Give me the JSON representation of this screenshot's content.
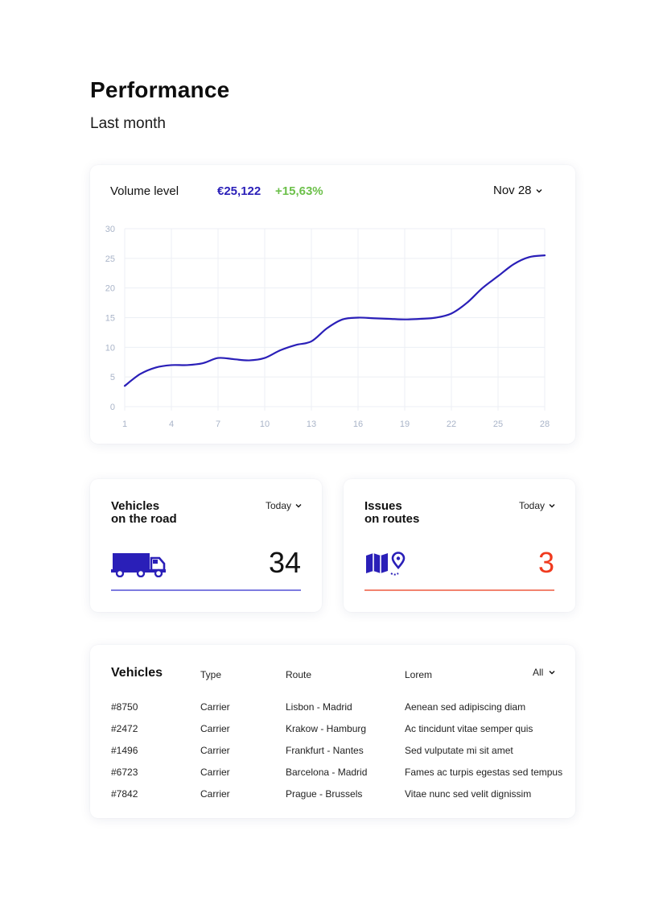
{
  "page": {
    "title": "Performance",
    "subtitle": "Last month"
  },
  "volume": {
    "label": "Volume level",
    "value": "€25,122",
    "change": "+15,63%",
    "date": "Nov 28",
    "line_color": "#2a1fb8",
    "value_color": "#2a1fb8",
    "change_color": "#6cc04a"
  },
  "chart_data": {
    "type": "line",
    "x": [
      1,
      2,
      3,
      4,
      5,
      6,
      7,
      8,
      9,
      10,
      11,
      12,
      13,
      14,
      15,
      16,
      17,
      18,
      19,
      20,
      21,
      22,
      23,
      24,
      25,
      26,
      27,
      28
    ],
    "series": [
      {
        "values": [
          3.5,
          5.5,
          6.6,
          7.0,
          7.0,
          7.3,
          8.2,
          8.0,
          7.8,
          8.2,
          9.5,
          10.4,
          11.0,
          13.2,
          14.7,
          15.0,
          14.9,
          14.8,
          14.7,
          14.8,
          15.0,
          15.7,
          17.5,
          20.0,
          22.0,
          24.0,
          25.2,
          25.5
        ]
      }
    ],
    "x_ticks": [
      "1",
      "4",
      "7",
      "10",
      "13",
      "16",
      "19",
      "22",
      "25",
      "28"
    ],
    "x_tick_values": [
      1,
      4,
      7,
      10,
      13,
      16,
      19,
      22,
      25,
      28
    ],
    "y_ticks": [
      "0",
      "5",
      "10",
      "15",
      "20",
      "25",
      "30"
    ],
    "y_tick_values": [
      0,
      5,
      10,
      15,
      20,
      25,
      30
    ],
    "xlim": [
      1,
      28
    ],
    "ylim": [
      0,
      30
    ],
    "grid": true,
    "legend": "none"
  },
  "vehicles_on_road": {
    "title_line1": "Vehicles",
    "title_line2": "on the road",
    "period": "Today",
    "value": "34",
    "icon": "truck-icon",
    "accent": "#2a1fb8",
    "line_color": "#7d7be0"
  },
  "issues_on_routes": {
    "title_line1": "Issues",
    "title_line2": "on routes",
    "period": "Today",
    "value": "3",
    "icon": "map-pin-icon",
    "accent": "#2a1fb8",
    "value_color": "#f03a1e",
    "line_color": "#f2836f"
  },
  "vehicles_table": {
    "title": "Vehicles",
    "columns": [
      "Type",
      "Route",
      "Lorem"
    ],
    "filter": "All",
    "rows": [
      [
        "#8750",
        "Carrier",
        "Lisbon - Madrid",
        "Aenean sed adipiscing diam"
      ],
      [
        "#2472",
        "Carrier",
        "Krakow - Hamburg",
        "Ac tincidunt vitae semper quis"
      ],
      [
        "#1496",
        "Carrier",
        "Frankfurt - Nantes",
        "Sed vulputate mi sit amet"
      ],
      [
        "#6723",
        "Carrier",
        "Barcelona - Madrid",
        "Fames ac turpis egestas sed tempus"
      ],
      [
        "#7842",
        "Carrier",
        "Prague - Brussels",
        "Vitae nunc sed velit dignissim"
      ]
    ]
  }
}
